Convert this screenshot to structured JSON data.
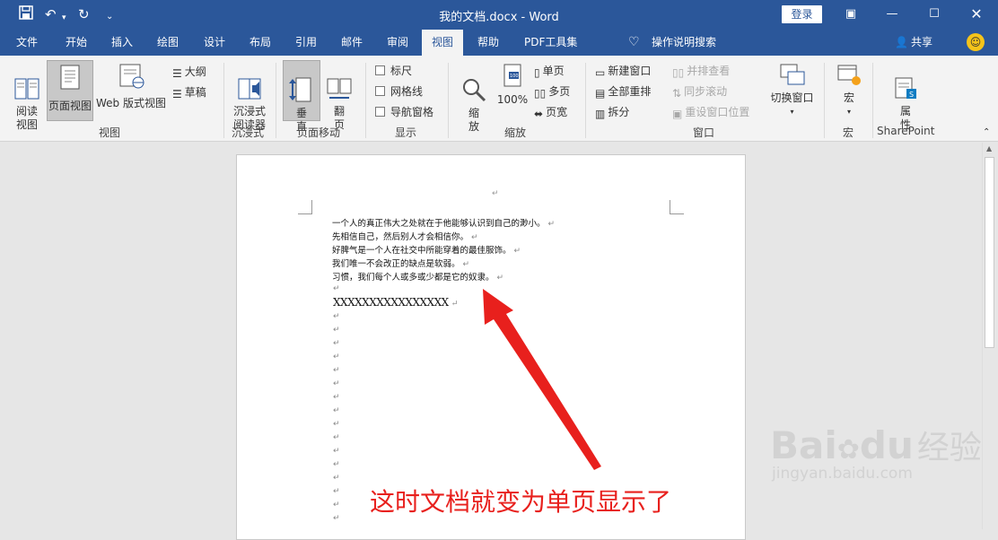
{
  "titlebar": {
    "title": "我的文档.docx  -  Word",
    "login": "登录"
  },
  "tabs": [
    {
      "label": "文件"
    },
    {
      "label": "开始"
    },
    {
      "label": "插入"
    },
    {
      "label": "绘图"
    },
    {
      "label": "设计"
    },
    {
      "label": "布局"
    },
    {
      "label": "引用"
    },
    {
      "label": "邮件"
    },
    {
      "label": "审阅"
    },
    {
      "label": "视图"
    },
    {
      "label": "帮助"
    },
    {
      "label": "PDF工具集"
    }
  ],
  "tell_me": "操作说明搜索",
  "share": "共享",
  "ribbon": {
    "views": {
      "read": "阅读\n视图",
      "print": "页面视图",
      "web": "Web 版式视图",
      "outline": "大纲",
      "draft": "草稿",
      "group": "视图"
    },
    "immersive": {
      "reader": "沉浸式\n阅读器",
      "group": "沉浸式"
    },
    "page_move": {
      "vertical": "垂\n直",
      "side": "翻\n页",
      "group": "页面移动"
    },
    "show": {
      "ruler": "标尺",
      "gridlines": "网格线",
      "nav": "导航窗格",
      "group": "显示"
    },
    "zoom": {
      "zoom": "缩\n放",
      "percent": "100%",
      "one": "单页",
      "multi": "多页",
      "width": "页宽",
      "group": "缩放"
    },
    "window": {
      "new": "新建窗口",
      "arrange": "全部重排",
      "split": "拆分",
      "side_by_side": "并排查看",
      "sync": "同步滚动",
      "reset": "重设窗口位置",
      "switch": "切换窗口",
      "group": "窗口"
    },
    "macros": {
      "macro": "宏",
      "group": "宏"
    },
    "sharepoint": {
      "props": "属\n性",
      "group": "SharePoint"
    }
  },
  "document": {
    "lines": [
      "一个人的真正伟大之处就在于他能够认识到自己的渺小。",
      "先相信自己，然后别人才会相信你。",
      "好脾气是一个人在社交中所能穿着的最佳服饰。",
      "我们唯一不会改正的缺点是软弱。",
      "习惯，我们每个人或多或少都是它的奴隶。"
    ],
    "typed": "XXXXXXXXXXXXXXXX",
    "paragraph_mark": "↵"
  },
  "annotation": "这时文档就变为单页显示了",
  "watermark": {
    "brand": "Bai",
    "brand2": "du",
    "cn": "经验",
    "url": "jingyan.baidu.com"
  },
  "colors": {
    "word_blue": "#2b579a",
    "annotation_red": "#e8201d"
  }
}
